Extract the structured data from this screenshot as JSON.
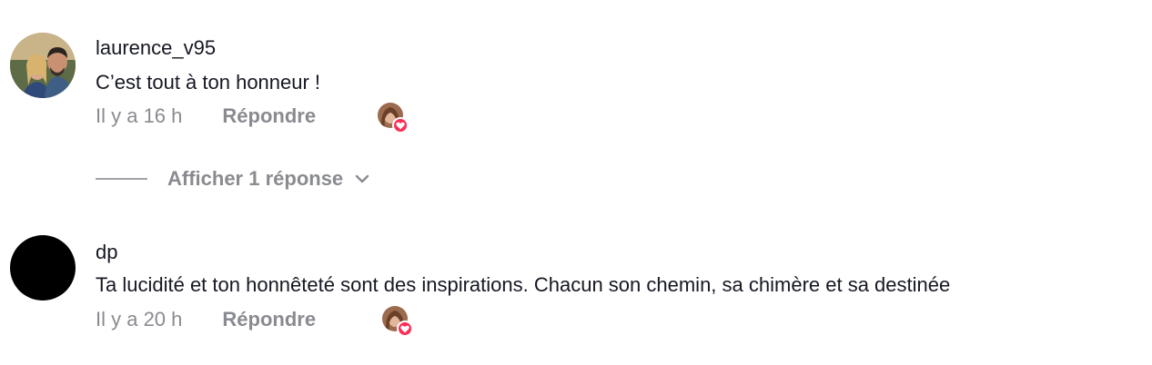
{
  "comments": [
    {
      "username": "laurence_v95",
      "text": "C’est tout à ton honneur !",
      "time": "Il y a 16 h",
      "reply_label": "Répondre",
      "avatar_icon": "couple-photo-avatar",
      "liked_by_creator": true
    },
    {
      "username": "dp",
      "text": "Ta lucidité et ton honnêteté sont des inspirations. Chacun son chemin, sa chimère et sa destinée",
      "time": "Il y a 20 h",
      "reply_label": "Répondre",
      "avatar_icon": "black-circle-avatar",
      "liked_by_creator": true
    }
  ],
  "view_replies": {
    "label": "Afficher 1 réponse",
    "icon": "chevron-down-icon"
  },
  "colors": {
    "primary_text": "#161823",
    "secondary_text": "#8a8b91",
    "heart": "#fe2c55"
  }
}
